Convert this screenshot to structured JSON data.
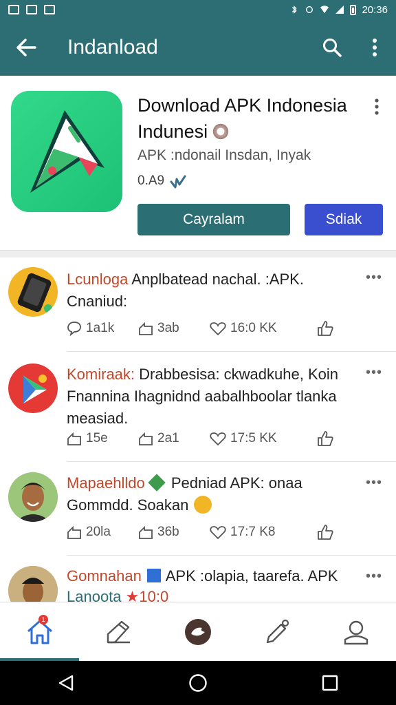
{
  "status_bar": {
    "time": "20:36"
  },
  "app_bar": {
    "title": "Indanload"
  },
  "app_card": {
    "name": "Download APK Indonesia Indunesi",
    "subtitle": "APK :ndonail Insdan, Inyak",
    "rating": "0.A9",
    "primary_button": "Cayralam",
    "secondary_button": "Sdiak"
  },
  "posts": [
    {
      "author": "Lcunloga",
      "text": " Anplbatead nachal. :APK. Cnaniud:",
      "stats": {
        "replies": "1a1k",
        "reposts": "3ab",
        "likes": "16:0 KK"
      }
    },
    {
      "author": "Komiraak:",
      "text": " Drabbesisa: ckwadkuhe, Koin Fnannina Ihagnidnd aabalhboolar tlanka measiad.",
      "stats": {
        "replies": "15e",
        "reposts": "2a1",
        "likes": "17:5 KK"
      }
    },
    {
      "author": "Mapaehlldo",
      "text": " Pedniad APK: onaa Gommdd. Soakan",
      "stats": {
        "replies": "20la",
        "reposts": "36b",
        "likes": "17:7 K8"
      }
    },
    {
      "author": "Gomnahan",
      "text": " APK :olapia, taarefa. APK",
      "subtext": "Lanoota",
      "value": "10:0"
    }
  ],
  "icons": {
    "back": "arrow-left",
    "search": "magnifier",
    "menu": "more-vertical",
    "home": "house",
    "compose": "pen",
    "community": "circle-logo",
    "edit": "pencil",
    "profile": "person",
    "notification_badge": "1"
  },
  "colors": {
    "toolbar": "#2c6e74",
    "primary_button": "#2b6f75",
    "secondary_button": "#3a4fd0",
    "author": "#c0482b",
    "app_icon": "#22c87c"
  }
}
